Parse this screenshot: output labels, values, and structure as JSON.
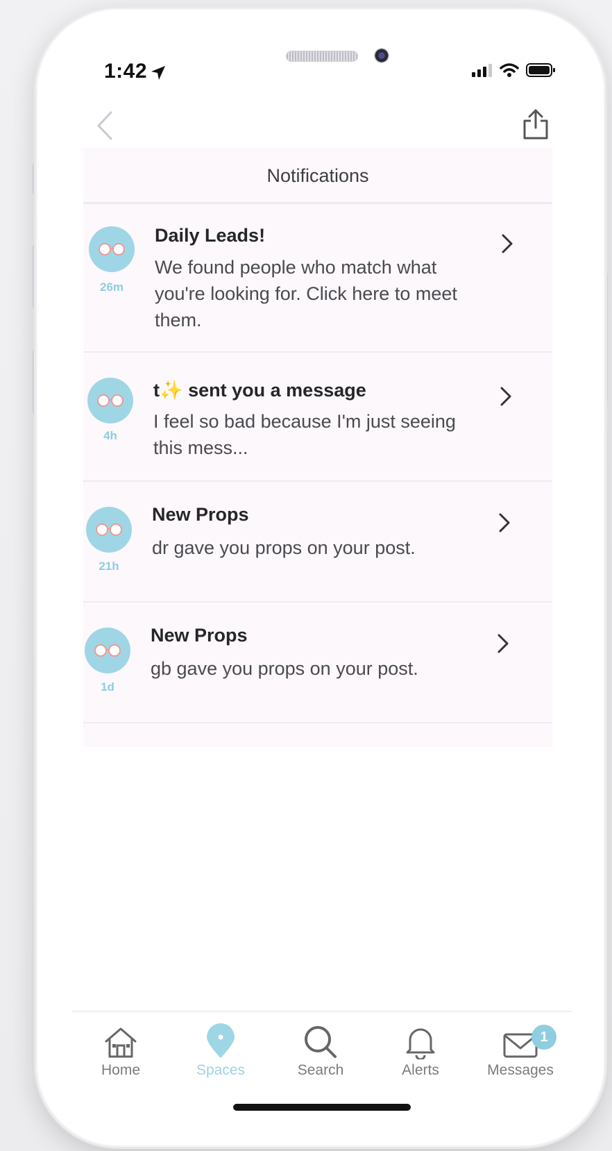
{
  "status_bar": {
    "time": "1:42"
  },
  "header": {
    "title": "Notifications"
  },
  "notifications": [
    {
      "age": "26m",
      "title": "Daily Leads!",
      "body_lines": [
        "We found people who match what",
        "you're looking for. Click here to meet",
        "them."
      ]
    },
    {
      "age": "4h",
      "title_prefix": "t",
      "title_emoji": "✨",
      "title": "sent you a message",
      "body_lines": [
        "I feel so bad because I'm just seeing",
        "this mess..."
      ]
    },
    {
      "age": "21h",
      "title": "New Props",
      "body_lines": [
        "dr gave you props on your post."
      ]
    },
    {
      "age": "1d",
      "title": "New Props",
      "body_lines": [
        "gb gave you props on your post."
      ]
    }
  ],
  "tabbar": {
    "home": "Home",
    "spaces": "Spaces",
    "search": "Search",
    "alerts": "Alerts",
    "messages": "Messages",
    "messages_badge": "1",
    "active_tab": "Spaces"
  },
  "colors": {
    "accent": "#9fd6e6",
    "panel_bg": "#fcf8fc",
    "text_dark": "#262629"
  }
}
